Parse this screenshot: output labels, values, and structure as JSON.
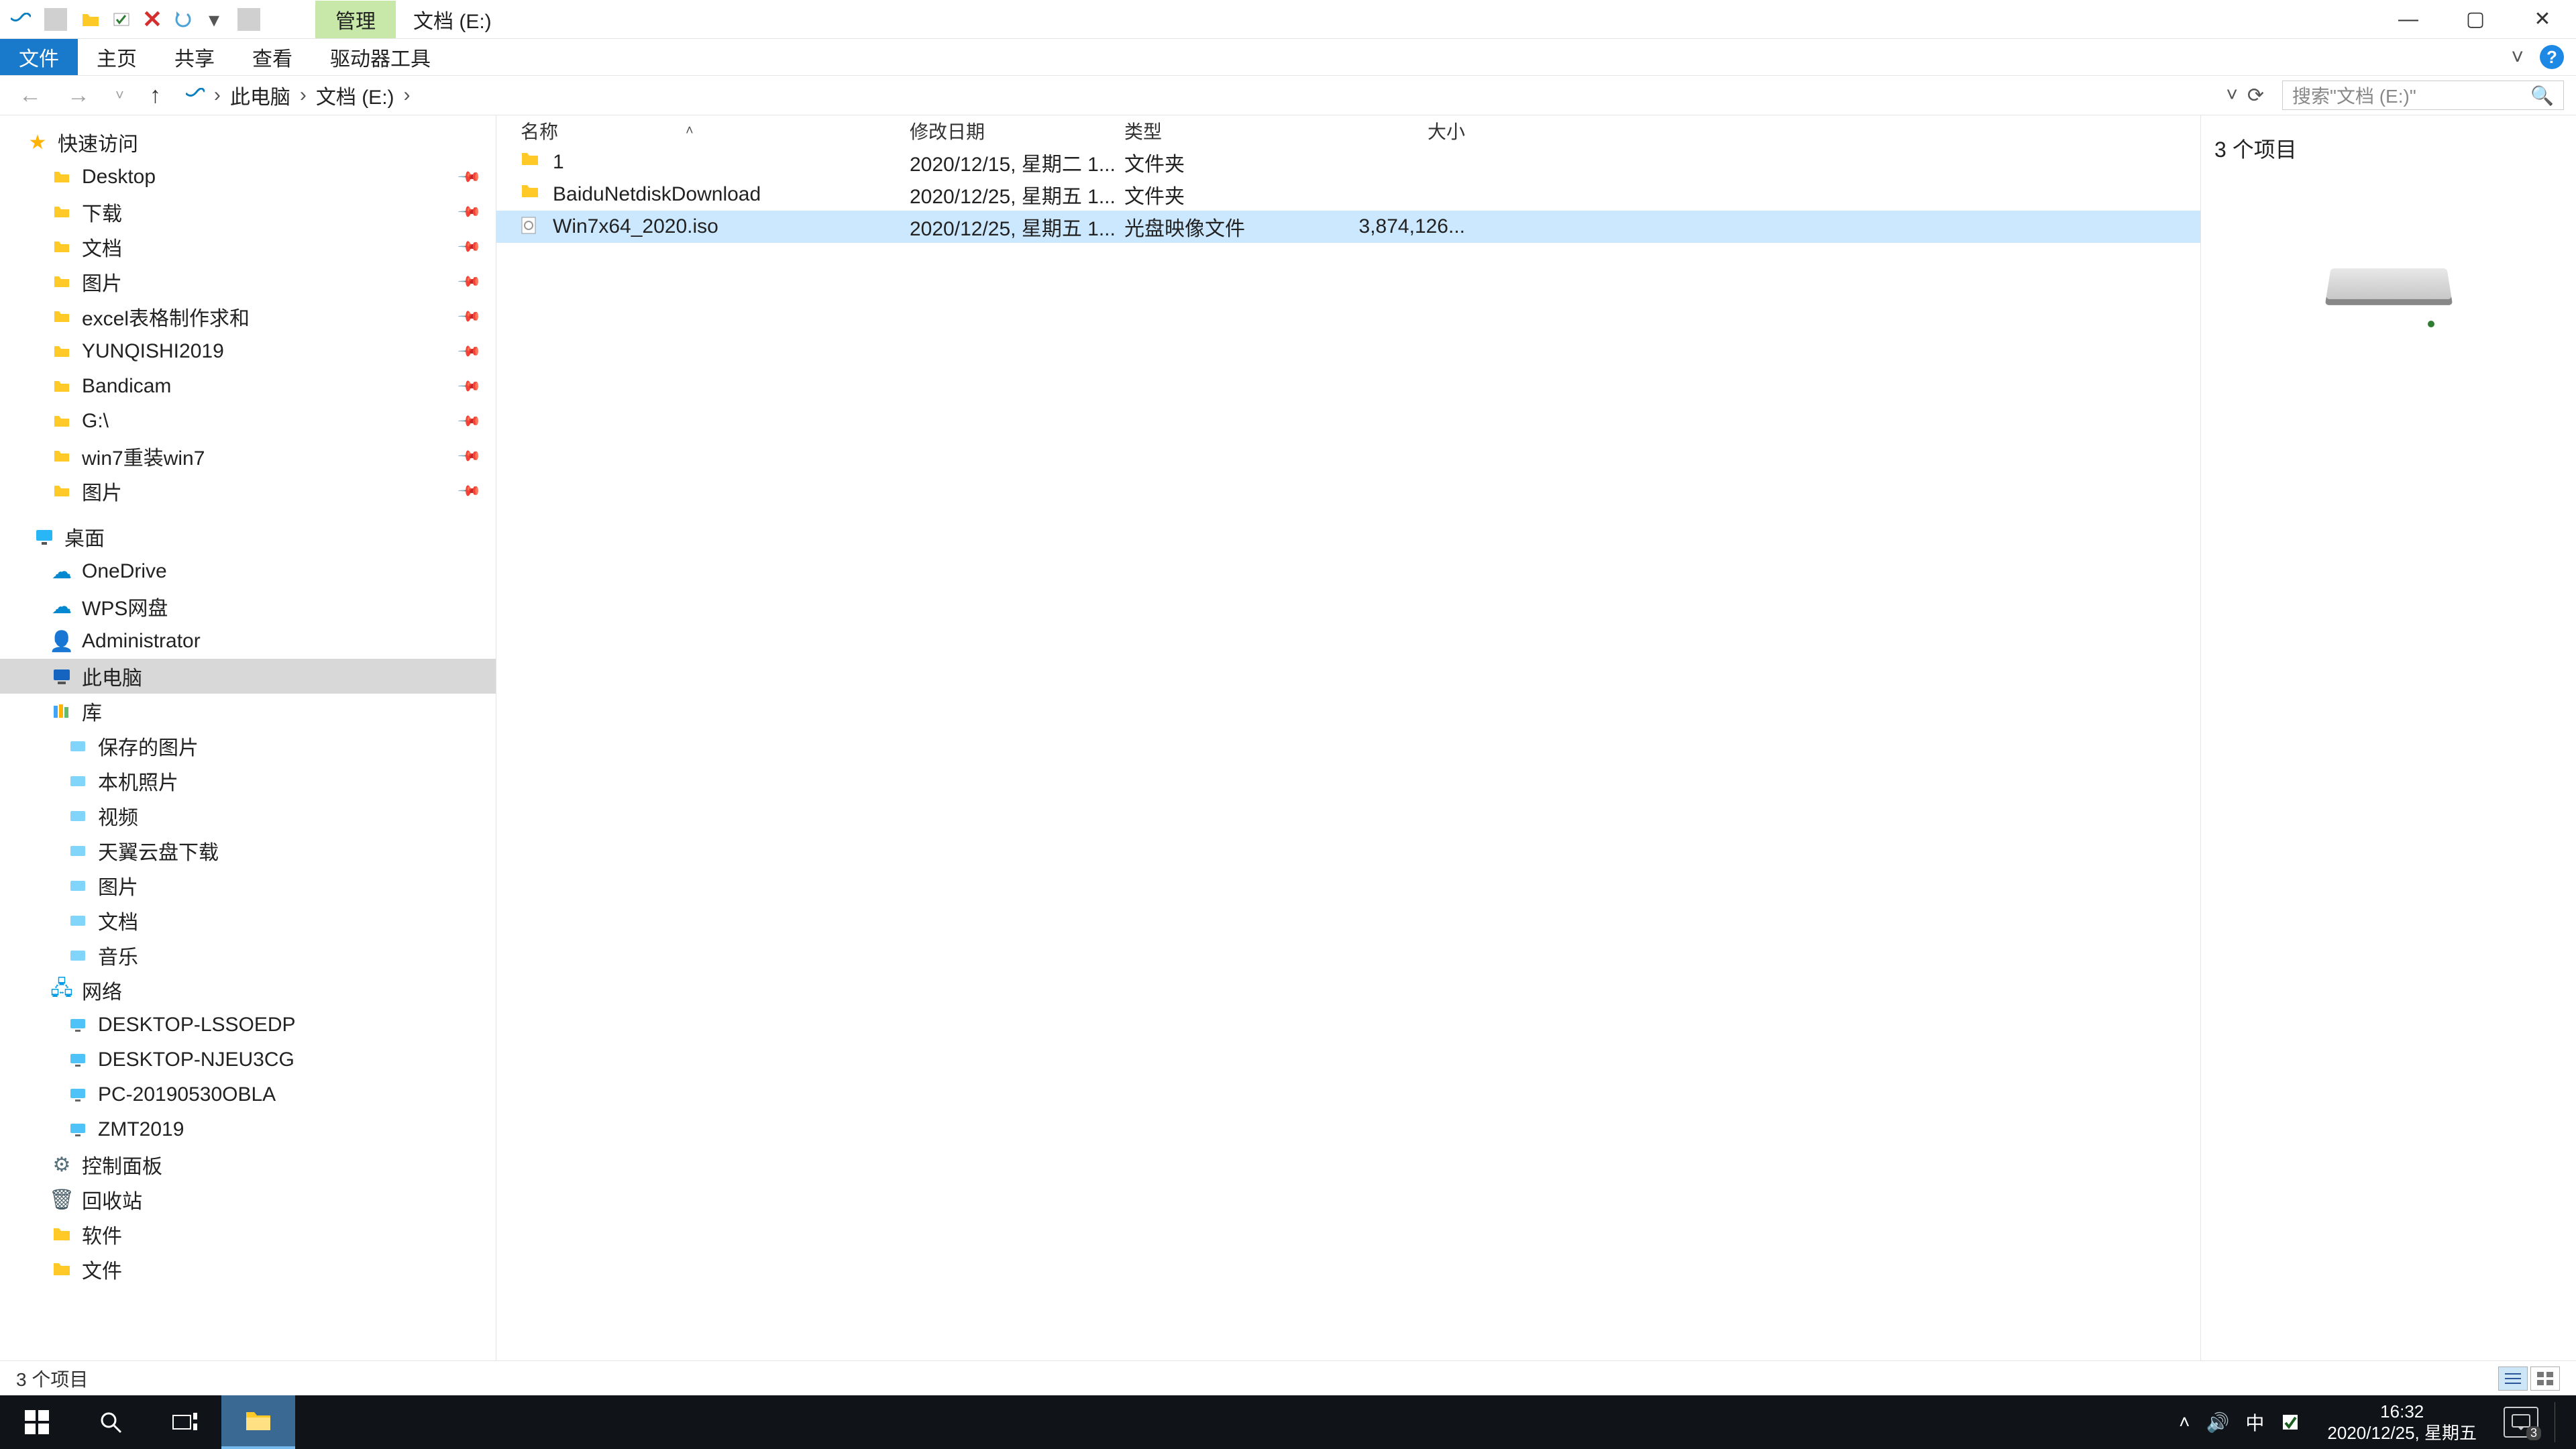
{
  "titlebar": {
    "management_tab": "管理",
    "drive_label": "文档 (E:)"
  },
  "ribbon": {
    "file": "文件",
    "home": "主页",
    "share": "共享",
    "view": "查看",
    "drive_tools": "驱动器工具"
  },
  "nav": {
    "breadcrumb": [
      "此电脑",
      "文档 (E:)"
    ],
    "refresh_title": "刷新",
    "search_placeholder": "搜索\"文档 (E:)\""
  },
  "sidebar": {
    "quick_access": "快速访问",
    "items_pinned": [
      {
        "label": "Desktop",
        "icon": "ico-desktop"
      },
      {
        "label": "下载",
        "icon": "ico-folder"
      },
      {
        "label": "文档",
        "icon": "ico-folder"
      },
      {
        "label": "图片",
        "icon": "ico-folder"
      },
      {
        "label": "excel表格制作求和",
        "icon": "ico-folder"
      },
      {
        "label": "YUNQISHI2019",
        "icon": "ico-folder2"
      },
      {
        "label": "Bandicam",
        "icon": "ico-folder"
      },
      {
        "label": "G:\\",
        "icon": "ico-drive"
      },
      {
        "label": "win7重装win7",
        "icon": "ico-folder"
      },
      {
        "label": "图片",
        "icon": "ico-folder"
      }
    ],
    "desktop": "桌面",
    "onedrive": "OneDrive",
    "wps": "WPS网盘",
    "admin": "Administrator",
    "thispc": "此电脑",
    "library": "库",
    "lib_items": [
      "保存的图片",
      "本机照片",
      "视频",
      "天翼云盘下载",
      "图片",
      "文档",
      "音乐"
    ],
    "network": "网络",
    "net_items": [
      "DESKTOP-LSSOEDP",
      "DESKTOP-NJEU3CG",
      "PC-20190530OBLA",
      "ZMT2019"
    ],
    "control_panel": "控制面板",
    "recycle": "回收站",
    "software": "软件",
    "docs": "文件"
  },
  "columns": {
    "name": "名称",
    "date": "修改日期",
    "type": "类型",
    "size": "大小"
  },
  "files": [
    {
      "name": "1",
      "date": "2020/12/15, 星期二 1...",
      "type": "文件夹",
      "size": "",
      "icon": "folder"
    },
    {
      "name": "BaiduNetdiskDownload",
      "date": "2020/12/25, 星期五 1...",
      "type": "文件夹",
      "size": "",
      "icon": "folder"
    },
    {
      "name": "Win7x64_2020.iso",
      "date": "2020/12/25, 星期五 1...",
      "type": "光盘映像文件",
      "size": "3,874,126...",
      "icon": "iso",
      "selected": true
    }
  ],
  "preview": {
    "count_label": "3 个项目"
  },
  "status": {
    "text": "3 个项目"
  },
  "taskbar": {
    "time": "16:32",
    "date": "2020/12/25, 星期五",
    "ime": "中",
    "notify_count": "3"
  }
}
